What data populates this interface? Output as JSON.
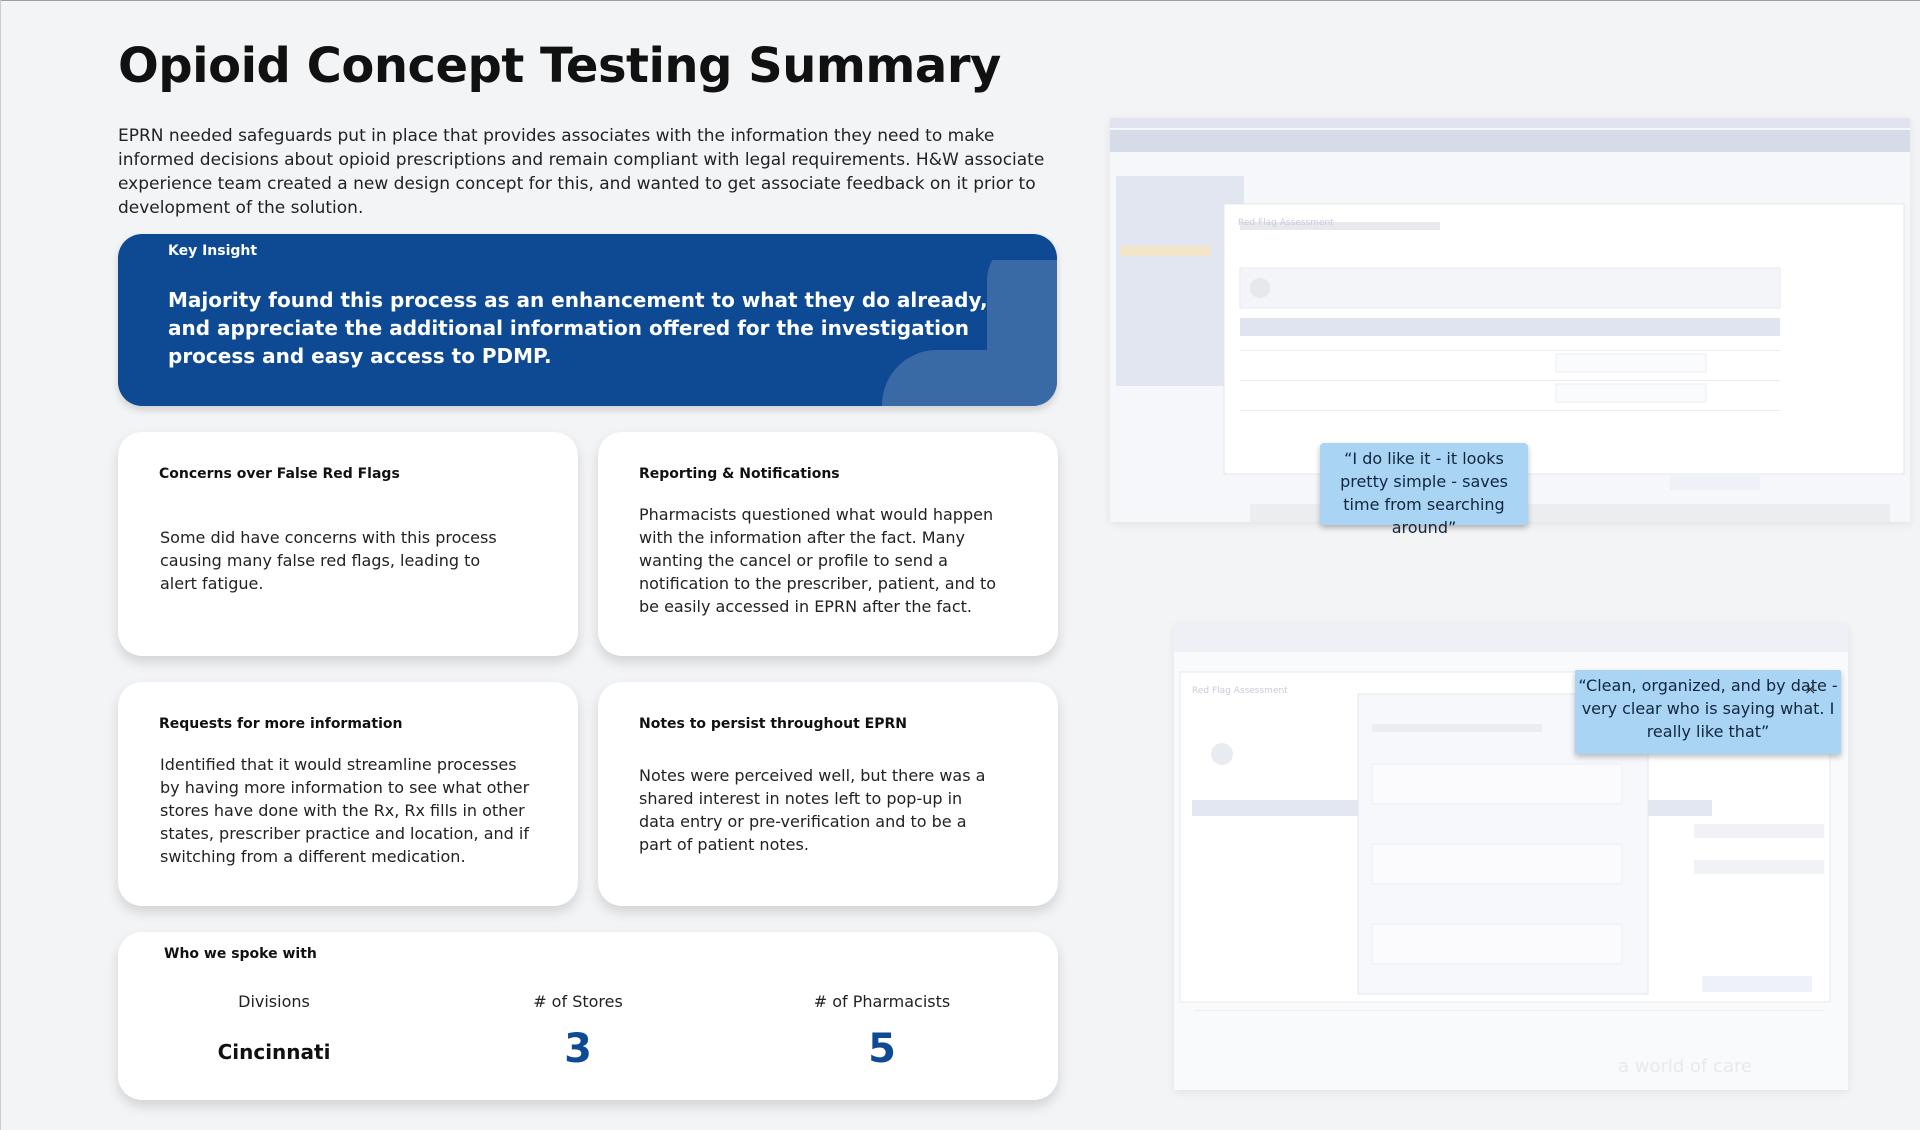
{
  "page": {
    "title": "Opioid Concept Testing Summary",
    "intro": "EPRN needed safeguards put in place that provides associates with the information they need to make informed decisions about opioid prescriptions and remain compliant with legal requirements. H&W associate experience team created a new design concept for this, and wanted to get associate feedback on it prior to development of the solution."
  },
  "insight": {
    "label": "Key Insight",
    "text": "Majority found this process as an enhancement to what they do already, and appreciate the additional information offered for the investigation process and easy access to PDMP."
  },
  "findings": [
    {
      "title": "Concerns over False Red Flags",
      "body": "Some did have concerns with this process causing many false red flags, leading to alert fatigue."
    },
    {
      "title": "Reporting & Notifications",
      "body": "Pharmacists questioned what would happen with the information after the fact. Many wanting the cancel or profile to send a notification to the prescriber, patient, and to be easily accessed in EPRN after the fact."
    },
    {
      "title": "Requests for more information",
      "body": "Identified that it would streamline processes by having more information to see what other stores have done with the Rx, Rx fills in other states, prescriber practice and location, and if switching from a different medication."
    },
    {
      "title": "Notes to persist throughout EPRN",
      "body": "Notes were perceived well, but there was a shared interest in notes left to pop-up in data entry or pre-verification and to be a part of patient notes."
    }
  ],
  "participants": {
    "title": "Who we spoke with",
    "stats": [
      {
        "label": "Divisions",
        "value": "Cincinnati"
      },
      {
        "label": "# of Stores",
        "value": "3"
      },
      {
        "label": "# of Pharmacists",
        "value": "5"
      }
    ]
  },
  "quotes": {
    "first": "“I do like it - it looks pretty simple - saves time from searching around”",
    "second": "“Clean, organized, and by date - very clear who is saying what. I really like that”"
  },
  "screenshots": {
    "first_title": "Red Flag Assessment",
    "second_title": "Red Flag Assessment",
    "watermark": "a world of care"
  },
  "colors": {
    "brand_blue": "#0e4a93",
    "quote_blue": "#a9d4f3",
    "stat_blue": "#0e4a93"
  },
  "icons": {
    "close": "×"
  }
}
